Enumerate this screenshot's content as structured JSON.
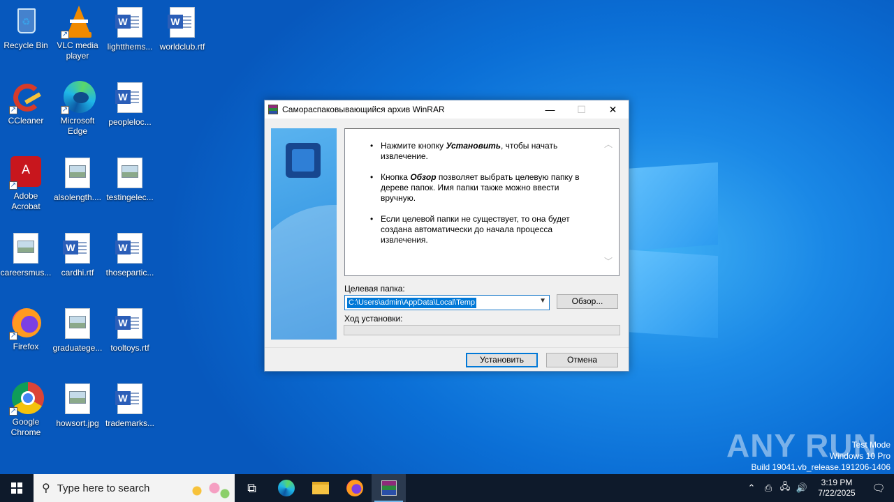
{
  "desktop": {
    "icons": [
      {
        "label": "Recycle Bin",
        "icon": "recycle-bin-icon"
      },
      {
        "label": "VLC media player",
        "icon": "vlc-icon"
      },
      {
        "label": "lightthems...",
        "icon": "word-document-icon"
      },
      {
        "label": "worldclub.rtf",
        "icon": "word-document-icon"
      },
      {
        "label": "CCleaner",
        "icon": "ccleaner-icon"
      },
      {
        "label": "Microsoft Edge",
        "icon": "edge-icon"
      },
      {
        "label": "peopleloc...",
        "icon": "word-document-icon"
      },
      {
        "label": "Adobe Acrobat",
        "icon": "acrobat-icon"
      },
      {
        "label": "alsolength....",
        "icon": "image-file-icon"
      },
      {
        "label": "testingelec...",
        "icon": "image-file-icon"
      },
      {
        "label": "careersmus...",
        "icon": "image-file-icon"
      },
      {
        "label": "cardhi.rtf",
        "icon": "word-document-icon"
      },
      {
        "label": "thosepartic...",
        "icon": "word-document-icon"
      },
      {
        "label": "Firefox",
        "icon": "firefox-icon"
      },
      {
        "label": "graduatege...",
        "icon": "image-file-icon"
      },
      {
        "label": "tooltoys.rtf",
        "icon": "word-document-icon"
      },
      {
        "label": "Google Chrome",
        "icon": "chrome-icon"
      },
      {
        "label": "howsort.jpg",
        "icon": "image-file-icon"
      },
      {
        "label": "trademarks...",
        "icon": "word-document-icon"
      }
    ]
  },
  "dialog": {
    "title": "Самораспаковывающийся архив WinRAR",
    "minimize": "—",
    "maximize": "☐",
    "close": "✕",
    "info": {
      "p1_pre": "Нажмите кнопку ",
      "p1_bold": "Установить",
      "p1_post": ", чтобы начать извлечение.",
      "p2_pre": "Кнопка ",
      "p2_bold": "Обзор",
      "p2_post": " позволяет выбрать целевую папку в дереве папок. Имя папки также можно ввести вручную.",
      "p3": "Если целевой папки не существует, то она будет создана автоматически до начала процесса извлечения."
    },
    "target_label": "Целевая папка:",
    "target_path": "C:\\Users\\admin\\AppData\\Local\\Temp",
    "browse_label": "Обзор...",
    "progress_label": "Ход установки:",
    "progress": 0,
    "install_label": "Установить",
    "cancel_label": "Отмена"
  },
  "watermark": {
    "line1": "Test Mode",
    "line2": "Windows 10 Pro",
    "line3": "Build 19041.vb_release.191206-1406",
    "brand": "ANY RUN"
  },
  "taskbar": {
    "search_placeholder": "Type here to search",
    "time": "3:19 PM",
    "date": "7/22/2025"
  }
}
